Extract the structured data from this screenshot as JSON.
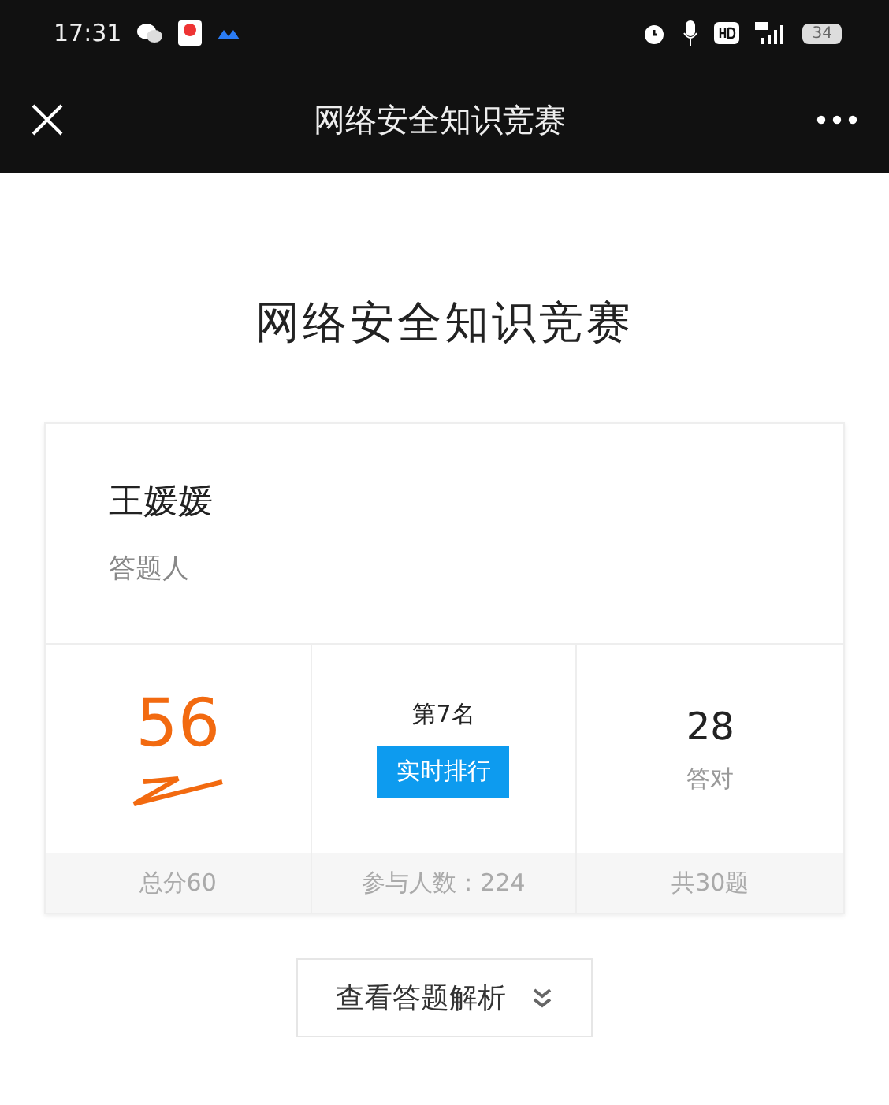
{
  "status_bar": {
    "time": "17:31",
    "battery": "34"
  },
  "header": {
    "title": "网络安全知识竞赛"
  },
  "page_title": "网络安全知识竞赛",
  "result_card": {
    "name": "王媛媛",
    "role": "答题人",
    "stats": [
      {
        "kind": "score",
        "value": "56",
        "footer": "总分60"
      },
      {
        "kind": "rank",
        "value": "第7名",
        "button": "实时排行",
        "footer": "参与人数：224"
      },
      {
        "kind": "correct",
        "value": "28",
        "label": "答对",
        "footer": "共30题"
      }
    ]
  },
  "review_button": "查看答题解析"
}
